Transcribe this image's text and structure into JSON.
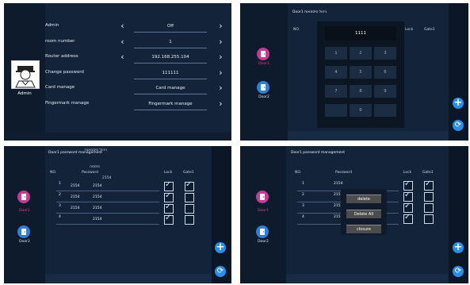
{
  "panel1": {
    "user_label": "Admin",
    "rows": [
      {
        "label": "Admin",
        "value": "Off"
      },
      {
        "label": "room number",
        "value": "1"
      },
      {
        "label": "Router address",
        "value": "192.168.255.104"
      },
      {
        "label": "Change password",
        "value": "111111"
      },
      {
        "label": "Card manage",
        "value": "Card manage"
      },
      {
        "label": "Fingermark manage",
        "value": "Fingermark manage"
      }
    ]
  },
  "panel2": {
    "title": "Door1 ניהול סיסמאות",
    "col_no": "NO.",
    "col_lock": "Lock",
    "col_gate": "Gate1",
    "keypad_display": "1111",
    "keys": [
      "1",
      "2",
      "3",
      "4",
      "5",
      "6",
      "7",
      "8",
      "9",
      "",
      "0",
      ""
    ],
    "door1_label": "Door1",
    "door2_label": "Door2"
  },
  "panel3": {
    "title": "Door1 password management",
    "title_overlay": "ניהול סיסמאות",
    "col_no": "NO.",
    "col_password": "Password",
    "col_password_overlay": "סיסמה",
    "col_lock": "Lock",
    "col_gate": "Gate1",
    "rows": [
      {
        "no": "1",
        "extra": "2154",
        "password": "2154",
        "lock": true,
        "gate": true,
        "top_ghost": "2154"
      },
      {
        "no": "2",
        "extra": "2154",
        "password": "2154",
        "lock": true,
        "gate": false,
        "top_ghost": ""
      },
      {
        "no": "3",
        "extra": "2154",
        "password": "2154",
        "lock": true,
        "gate": false,
        "top_ghost": ""
      },
      {
        "no": "4",
        "extra": "",
        "password": "2154",
        "lock": true,
        "gate": false,
        "top_ghost": ""
      }
    ],
    "door1_label": "Door1",
    "door2_label": "Door2"
  },
  "panel4": {
    "title": "Door1 password management",
    "col_no": "NO.",
    "col_password": "Password",
    "col_lock": "Lock",
    "col_gate": "Gate1",
    "rows": [
      {
        "no": "1",
        "password": "2154",
        "lock": true,
        "gate": true
      },
      {
        "no": "2",
        "password": "215",
        "lock": true,
        "gate": false
      },
      {
        "no": "3",
        "password": "215",
        "lock": true,
        "gate": false
      },
      {
        "no": "4",
        "password": "215",
        "lock": true,
        "gate": false
      }
    ],
    "menu": [
      "delete",
      "Delete All",
      "closure"
    ],
    "door1_label": "Door1",
    "door2_label": "Door2"
  },
  "colors": {
    "accent_blue": "#2a8ee8",
    "door_pink": "#c43a95",
    "door_blue": "#2d7fd8",
    "bg_dark": "#0b1626"
  }
}
